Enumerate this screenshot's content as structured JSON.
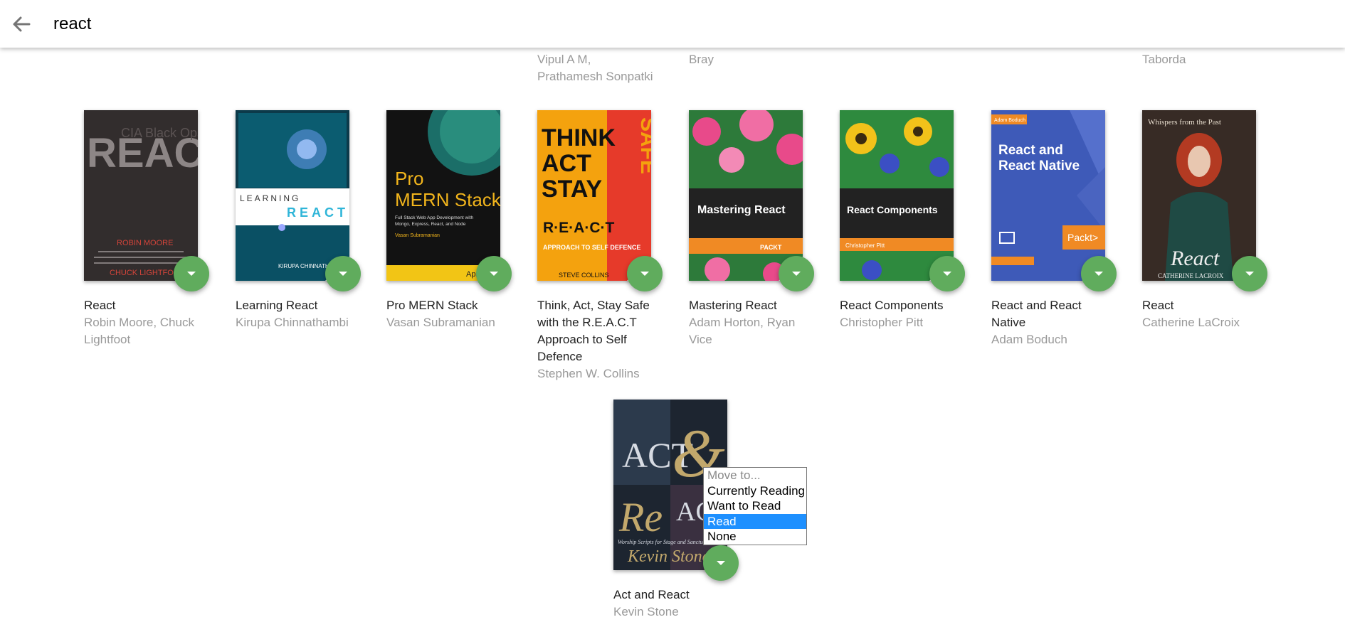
{
  "search": {
    "value": "react",
    "back_label": "Back"
  },
  "top_fragments": [
    {
      "authors": "Vipul A M, Prathamesh Sonpatki"
    },
    {
      "authors": "Bray"
    },
    {
      "authors": "Taborda"
    }
  ],
  "books": [
    {
      "title": "React",
      "authors": "Robin Moore, Chuck Lightfoot",
      "cover_text": [
        "REACT",
        "CIA Black Ops",
        "ROBIN MOORE",
        "CHUCK LIGHTFOOT"
      ]
    },
    {
      "title": "Learning React",
      "authors": "Kirupa Chinnathambi",
      "cover_text": [
        "LEARNING",
        "REACT",
        "KIRUPA CHINNATHAMBI"
      ]
    },
    {
      "title": "Pro MERN Stack",
      "authors": "Vasan Subramanian",
      "cover_text": [
        "Pro",
        "MERN Stack",
        "Full Stack Web App Development with",
        "Mongo, Express, React, and Node",
        "Vasan Subramanian",
        "Apress"
      ]
    },
    {
      "title": "Think, Act, Stay Safe with the R.E.A.C.T Approach to Self Defence",
      "authors": "Stephen W. Collins",
      "cover_text": [
        "THINK",
        "ACT",
        "STAY",
        "SAFE",
        "R·E·A·C·T",
        "APPROACH TO SELF DEFENCE",
        "STEVE COLLINS"
      ]
    },
    {
      "title": "Mastering React",
      "authors": "Adam Horton, Ryan Vice",
      "cover_text": [
        "Mastering React",
        "PACKT"
      ]
    },
    {
      "title": "React Components",
      "authors": "Christopher Pitt",
      "cover_text": [
        "React Components",
        "Christopher Pitt"
      ]
    },
    {
      "title": "React and React Native",
      "authors": "Adam Boduch",
      "cover_text": [
        "Adam Boduch",
        "React and",
        "React Native",
        "Packt>"
      ]
    },
    {
      "title": "React",
      "authors": "Catherine LaCroix",
      "cover_text": [
        "Whispers from the Past",
        "React",
        "CATHERINE LACROIX"
      ]
    },
    {
      "title": "Act and React",
      "authors": "Kevin Stone",
      "cover_text": [
        "ACT",
        "&",
        "Re",
        "ACT",
        "Worship Scripts for Stage and Sanctuary",
        "Kevin Stone"
      ]
    }
  ],
  "shelf_menu": {
    "options": [
      "Move to...",
      "Currently Reading",
      "Want to Read",
      "Read",
      "None"
    ],
    "selected": "Read"
  },
  "colors": {
    "shelf_button": "#60ac5d",
    "selected_option": "#1e90ff"
  }
}
